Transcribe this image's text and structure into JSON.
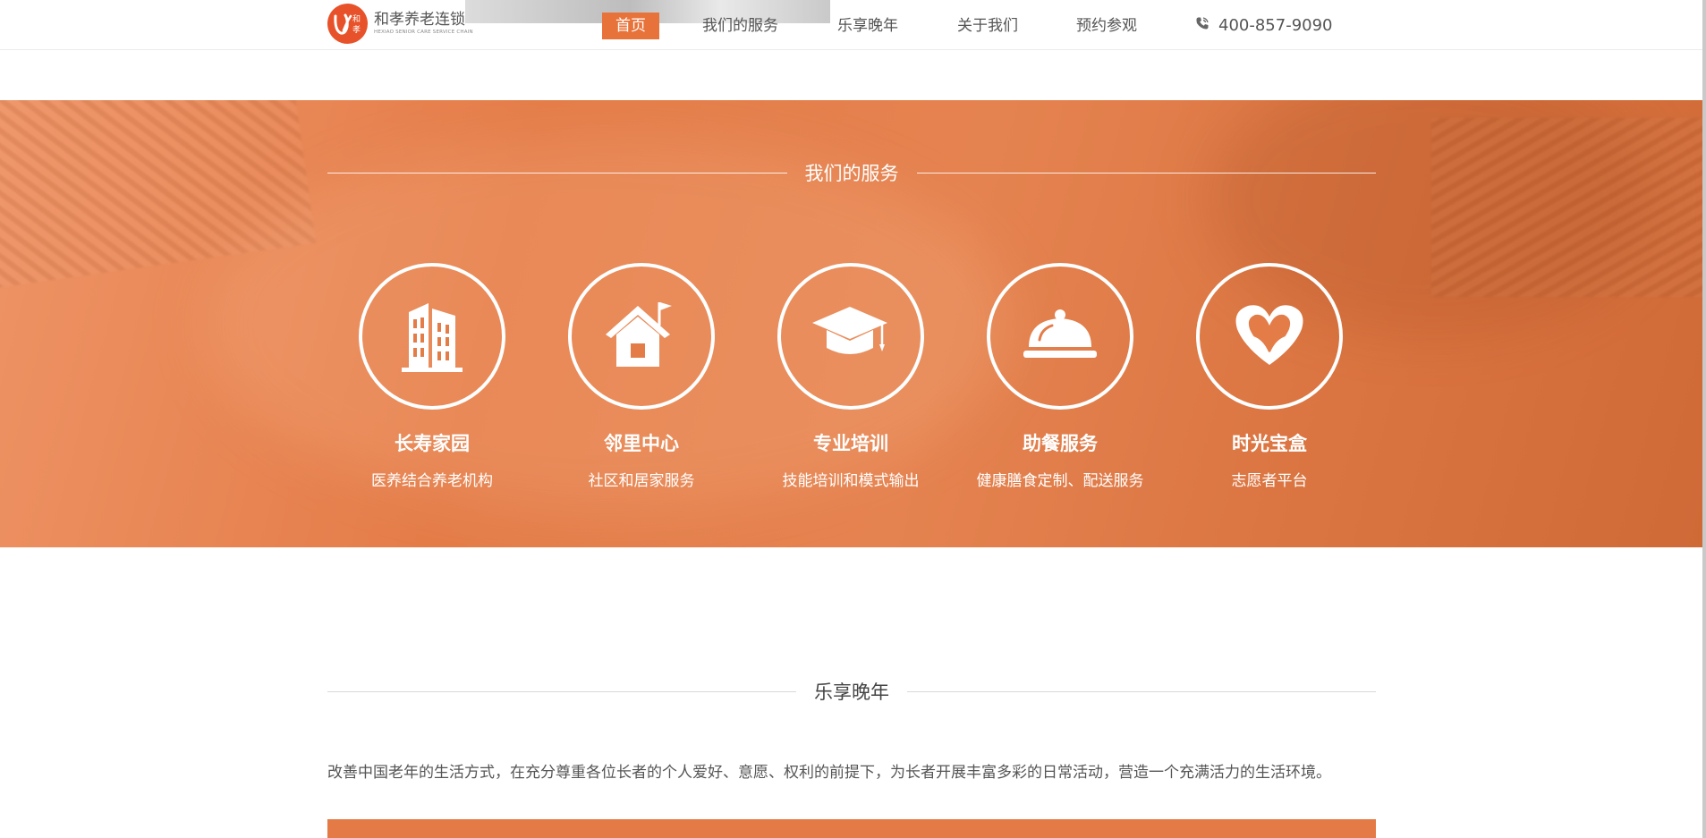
{
  "brand": {
    "name_cn": "和孝养老连锁",
    "name_en": "HEXIAO SENIOR CARE SERVICE CHAIN",
    "logo_glyph": "和孝",
    "accent": "#e8733a",
    "logo_color": "#e8522a"
  },
  "nav": {
    "items": [
      {
        "label": "首页",
        "active": true
      },
      {
        "label": "我们的服务",
        "active": false
      },
      {
        "label": "乐享晚年",
        "active": false
      },
      {
        "label": "关于我们",
        "active": false
      },
      {
        "label": "预约参观",
        "active": false
      }
    ],
    "phone_icon": "phone-icon",
    "phone": "400-857-9090"
  },
  "services": {
    "heading": "我们的服务",
    "items": [
      {
        "icon": "buildings-icon",
        "title": "长寿家园",
        "subtitle": "医养结合养老机构"
      },
      {
        "icon": "house-flag-icon",
        "title": "邻里中心",
        "subtitle": "社区和居家服务"
      },
      {
        "icon": "graduation-cap-icon",
        "title": "专业培训",
        "subtitle": "技能培训和模式输出"
      },
      {
        "icon": "food-cloche-icon",
        "title": "助餐服务",
        "subtitle": "健康膳食定制、配送服务"
      },
      {
        "icon": "heart-leaves-icon",
        "title": "时光宝盒",
        "subtitle": "志愿者平台"
      }
    ]
  },
  "lexiang": {
    "heading": "乐享晚年",
    "description": "改善中国老年的生活方式，在充分尊重各位长者的个人爱好、意愿、权利的前提下，为长者开展丰富多彩的日常活动，营造一个充满活力的生活环境。"
  }
}
